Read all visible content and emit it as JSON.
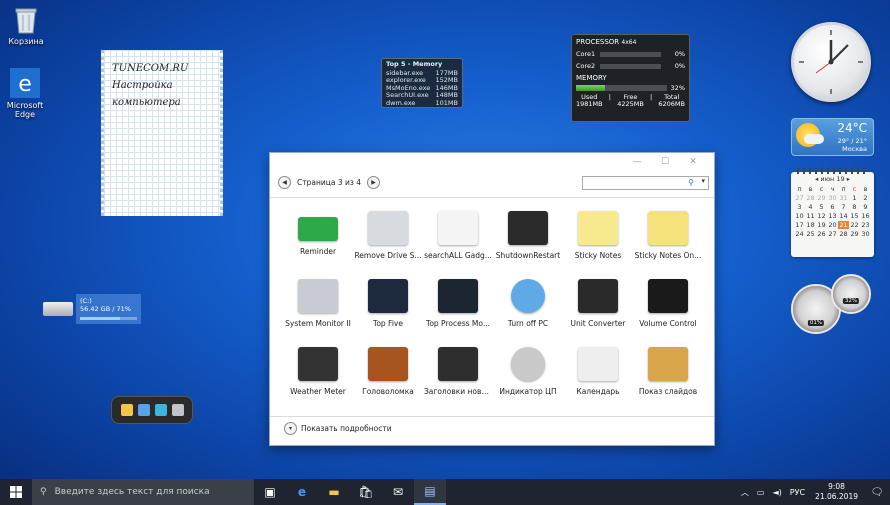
{
  "desktop": {
    "icons": [
      {
        "label": "Корзина"
      },
      {
        "label": "Microsoft Edge"
      }
    ]
  },
  "note": {
    "lines": [
      "TUNECOM.RU",
      "Настройка",
      "компьютера"
    ]
  },
  "top5": {
    "title": "Top 5 - Memory",
    "rows": [
      {
        "name": "sidebar.exe",
        "mem": "177MB"
      },
      {
        "name": "explorer.exe",
        "mem": "152MB"
      },
      {
        "name": "MsMoEno.exe",
        "mem": "146MB"
      },
      {
        "name": "SearchUI.exe",
        "mem": "148MB"
      },
      {
        "name": "dwm.exe",
        "mem": "101MB"
      }
    ]
  },
  "processor": {
    "title": "PROCESSOR",
    "arch": "4x64",
    "cores": [
      {
        "name": "Core1",
        "pct": "0%"
      },
      {
        "name": "Core2",
        "pct": "0%"
      }
    ],
    "memory_title": "MEMORY",
    "memory_pct": "32%",
    "memory_fill": 0.32,
    "used_label": "Used",
    "used": "1981MB",
    "free_label": "Free",
    "free": "4225MB",
    "total_label": "Total",
    "total": "6206MB"
  },
  "weather": {
    "temp": "24°C",
    "range": "29° / 21°",
    "city": "Москва"
  },
  "calendar": {
    "month": "июн 19",
    "weekdays": [
      "п",
      "в",
      "с",
      "ч",
      "п",
      "с",
      "в"
    ],
    "days": [
      "27",
      "28",
      "29",
      "30",
      "31",
      "1",
      "2",
      "3",
      "4",
      "5",
      "6",
      "7",
      "8",
      "9",
      "10",
      "11",
      "12",
      "13",
      "14",
      "15",
      "16",
      "17",
      "18",
      "19",
      "20",
      "21",
      "22",
      "23",
      "24",
      "25",
      "26",
      "27",
      "28",
      "29",
      "30"
    ],
    "today": "21"
  },
  "gauges": {
    "cpu": "01%",
    "mem": "32%"
  },
  "drive": {
    "name": "(C:)",
    "info": "56.42 GB / 71%",
    "fill": 0.71
  },
  "gadget_window": {
    "minimize": "—",
    "maximize": "☐",
    "close": "✕",
    "page_label": "Страница 3 из 4",
    "search_placeholder": "",
    "tiles": [
      {
        "label": "Reminder",
        "icon": "reminder-icon"
      },
      {
        "label": "Remove Drive S...",
        "icon": "usb-drive-icon"
      },
      {
        "label": "searchALL Gadg...",
        "icon": "google-search-icon"
      },
      {
        "label": "ShutdownRestart",
        "icon": "shutdown-restart-icon"
      },
      {
        "label": "Sticky Notes",
        "icon": "sticky-note-icon"
      },
      {
        "label": "Sticky Notes On...",
        "icon": "sticky-note-online-icon"
      },
      {
        "label": "System Monitor II",
        "icon": "cpu-chip-icon"
      },
      {
        "label": "Top Five",
        "icon": "top-five-icon"
      },
      {
        "label": "Top Process Mo...",
        "icon": "process-monitor-icon"
      },
      {
        "label": "Turn off PC",
        "icon": "power-icon"
      },
      {
        "label": "Unit Converter",
        "icon": "unit-converter-icon"
      },
      {
        "label": "Volume Control",
        "icon": "volume-control-icon"
      },
      {
        "label": "Weather Meter",
        "icon": "weather-meter-icon"
      },
      {
        "label": "Головоломка",
        "icon": "puzzle-icon"
      },
      {
        "label": "Заголовки новостей",
        "icon": "news-headlines-icon"
      },
      {
        "label": "Индикатор ЦП",
        "icon": "cpu-meter-icon"
      },
      {
        "label": "Календарь",
        "icon": "calendar-icon"
      },
      {
        "label": "Показ слайдов",
        "icon": "slideshow-icon"
      }
    ],
    "details_label": "Показать подробности"
  },
  "taskbar": {
    "search_placeholder": "Введите здесь текст для поиска",
    "lang": "РУС",
    "time": "9:08",
    "date": "21.06.2019"
  }
}
